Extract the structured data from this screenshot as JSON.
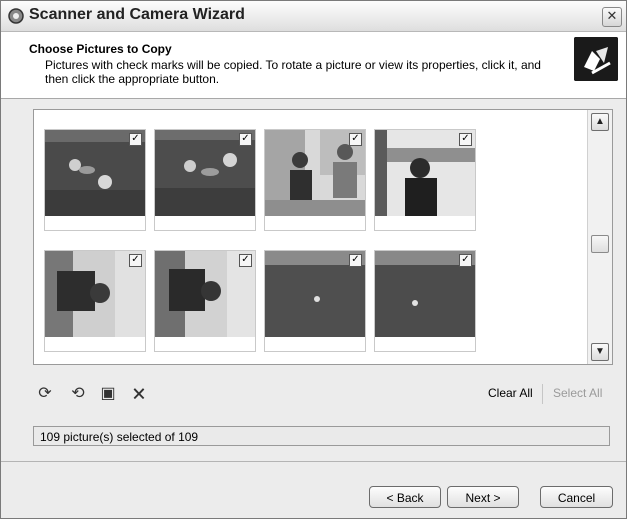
{
  "window": {
    "title": "Scanner and Camera Wizard"
  },
  "header": {
    "title": "Choose Pictures to Copy",
    "description": "Pictures with check marks will be copied. To rotate a picture or view its properties, click it, and then click the appropriate button."
  },
  "thumbnails": [
    {
      "checked": true,
      "scene": "sea-swimmers"
    },
    {
      "checked": true,
      "scene": "sea-swimmers"
    },
    {
      "checked": true,
      "scene": "boat-people"
    },
    {
      "checked": true,
      "scene": "girl-portrait"
    },
    {
      "checked": true,
      "scene": "rotated-person"
    },
    {
      "checked": true,
      "scene": "rotated-person"
    },
    {
      "checked": true,
      "scene": "open-sea"
    },
    {
      "checked": true,
      "scene": "open-sea"
    }
  ],
  "toolbar": {
    "icons": [
      "rotate-clockwise-icon",
      "rotate-counterclockwise-icon",
      "properties-icon",
      "delete-icon"
    ],
    "clear_all": "Clear All",
    "select_all": "Select All"
  },
  "status": {
    "text": "109 picture(s) selected of 109"
  },
  "buttons": {
    "back": "< Back",
    "next": "Next >",
    "cancel": "Cancel"
  }
}
